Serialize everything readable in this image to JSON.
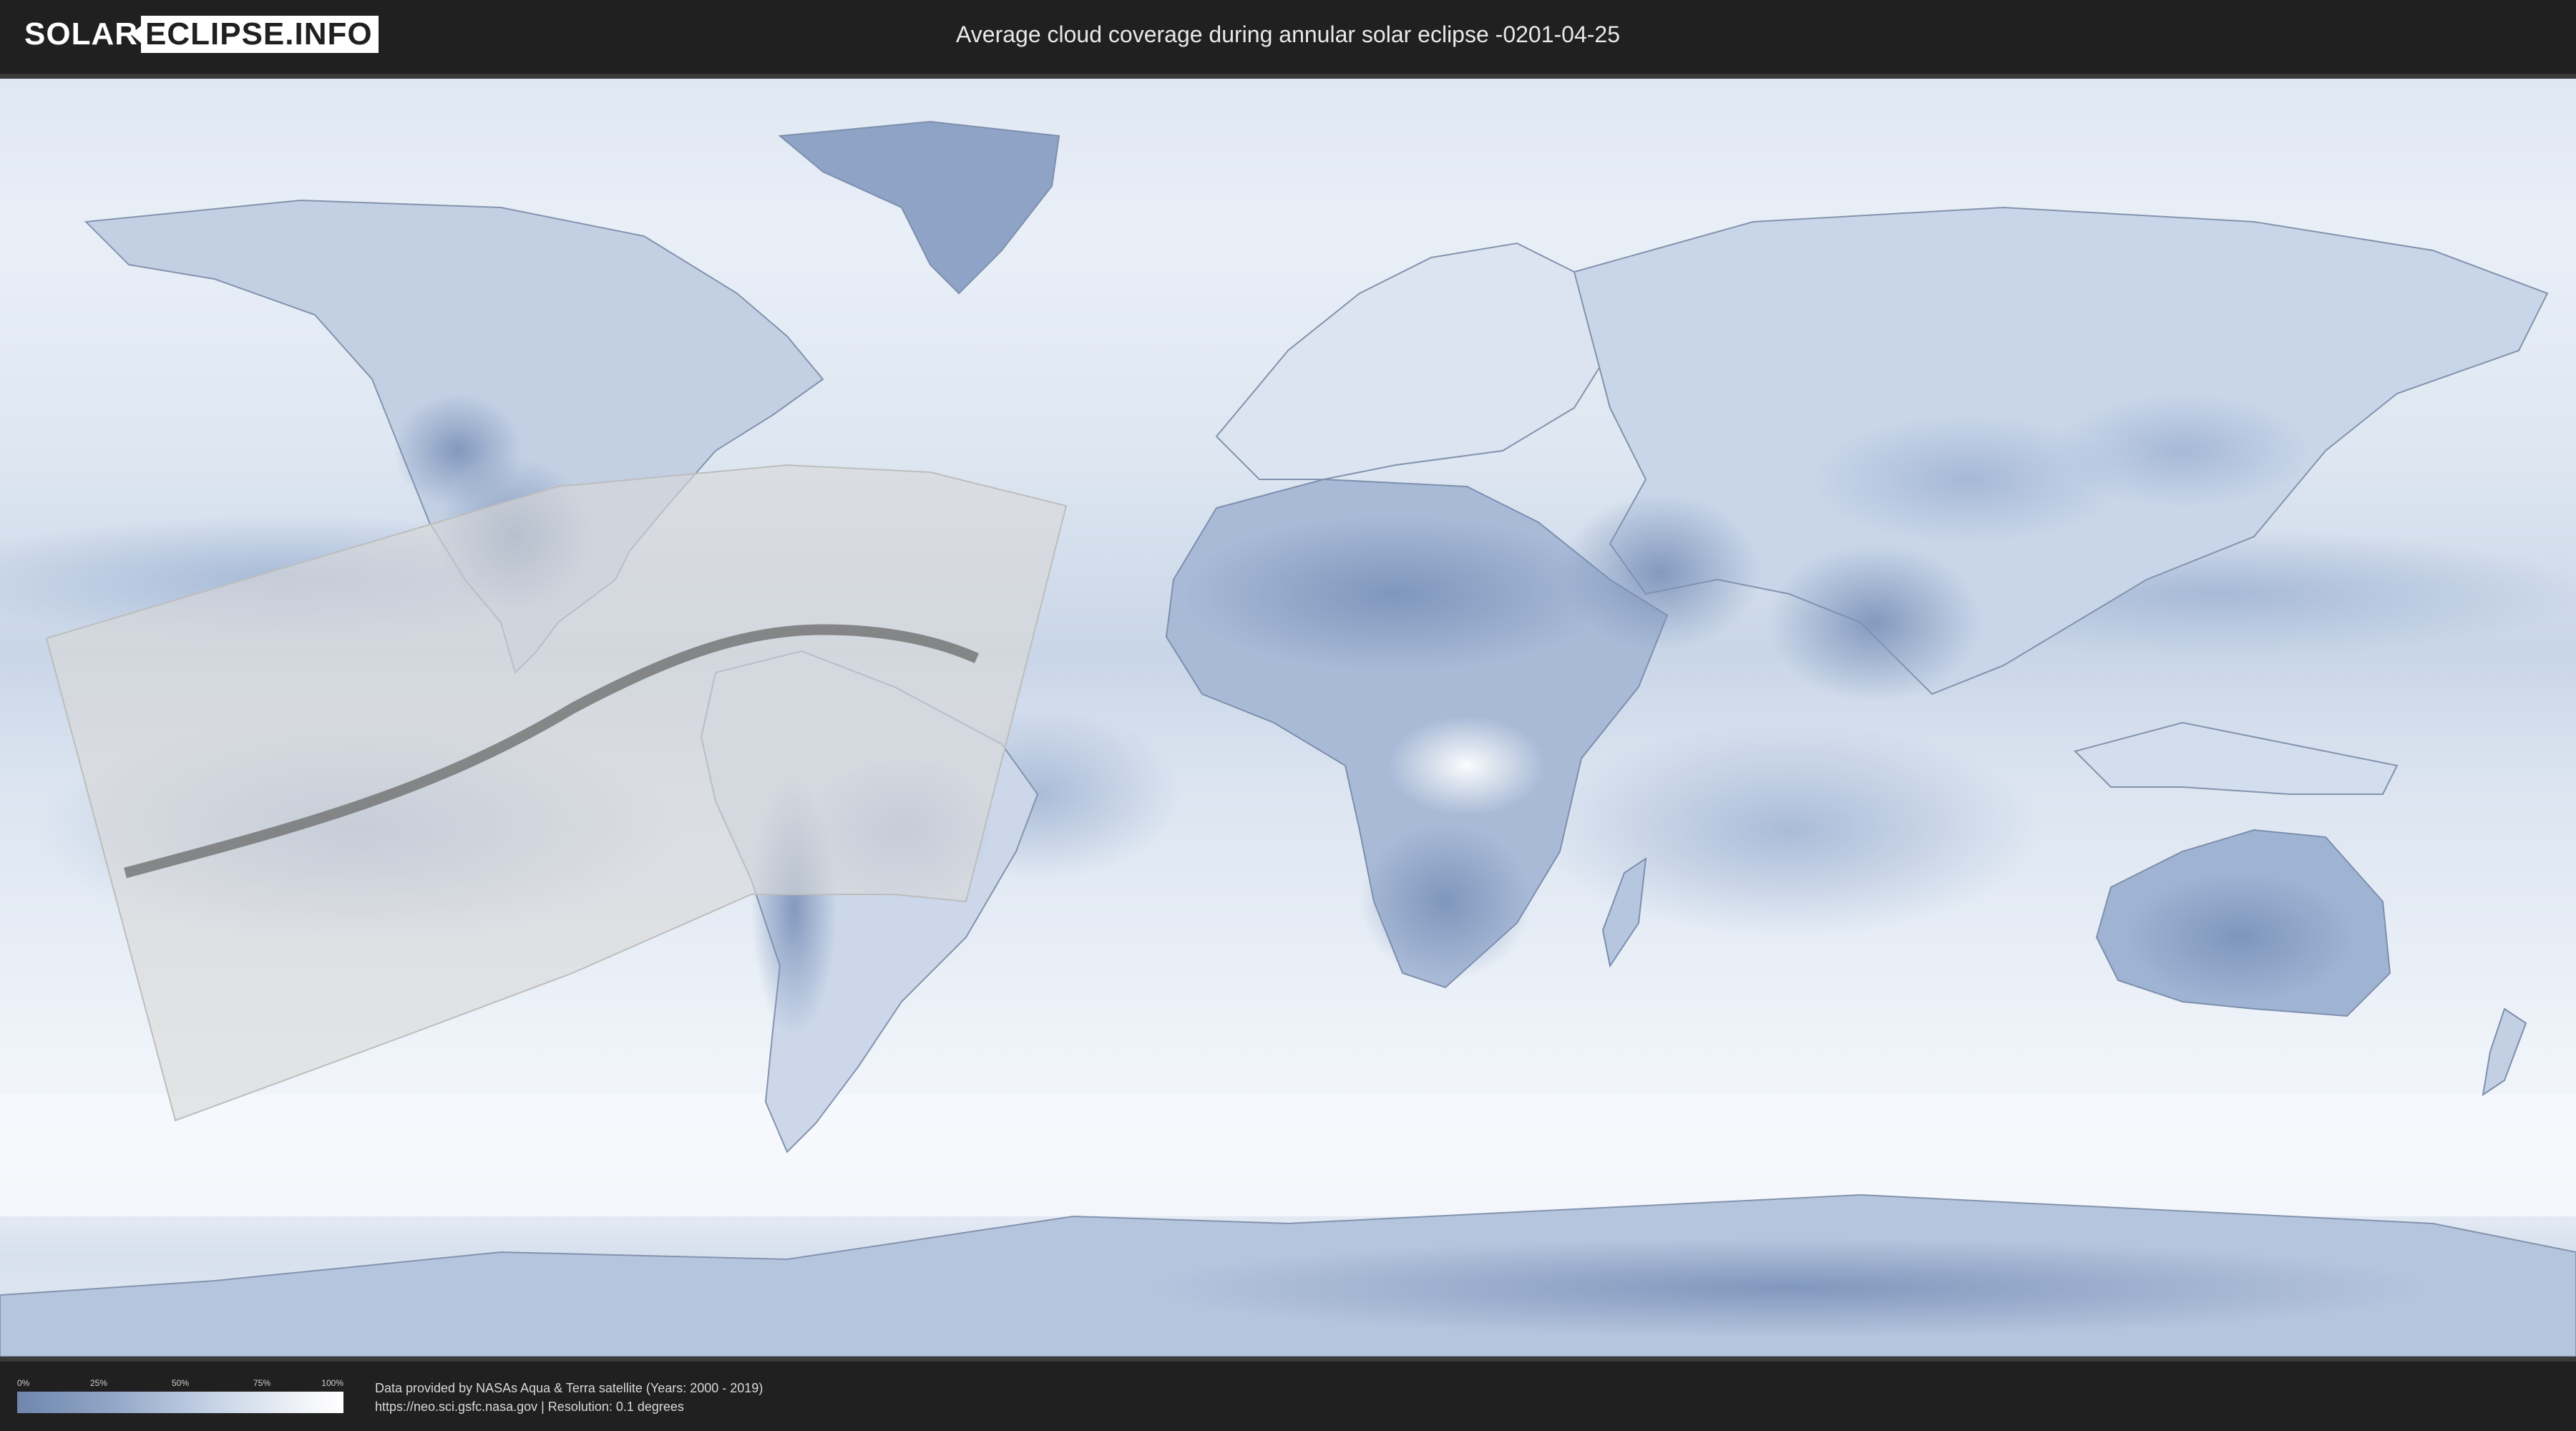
{
  "header": {
    "logo_solar": "SOLAR",
    "logo_eclipse": "ECLIPSE.INFO",
    "title": "Average cloud coverage during annular solar eclipse -0201-04-25"
  },
  "map": {
    "type": "world cloud coverage map",
    "projection": "equirectangular",
    "colors": {
      "ocean_cloudy": "#eef3f9",
      "low_cloud": "#7a91b8",
      "mid_cloud": "#a9bcd8",
      "eclipse_path_shade": "#d9d9d9",
      "central_line": "#6f6f6f"
    }
  },
  "legend": {
    "ticks": [
      "0%",
      "25%",
      "50%",
      "75%",
      "100%"
    ],
    "ticks_pos": [
      0,
      25,
      50,
      75,
      100
    ],
    "color_low": "#6f86ad",
    "color_high": "#ffffff"
  },
  "footer": {
    "line1": "Data provided by NASAs Aqua & Terra satellite (Years: 2000 - 2019)",
    "line2": "https://neo.sci.gsfc.nasa.gov | Resolution: 0.1 degrees"
  }
}
